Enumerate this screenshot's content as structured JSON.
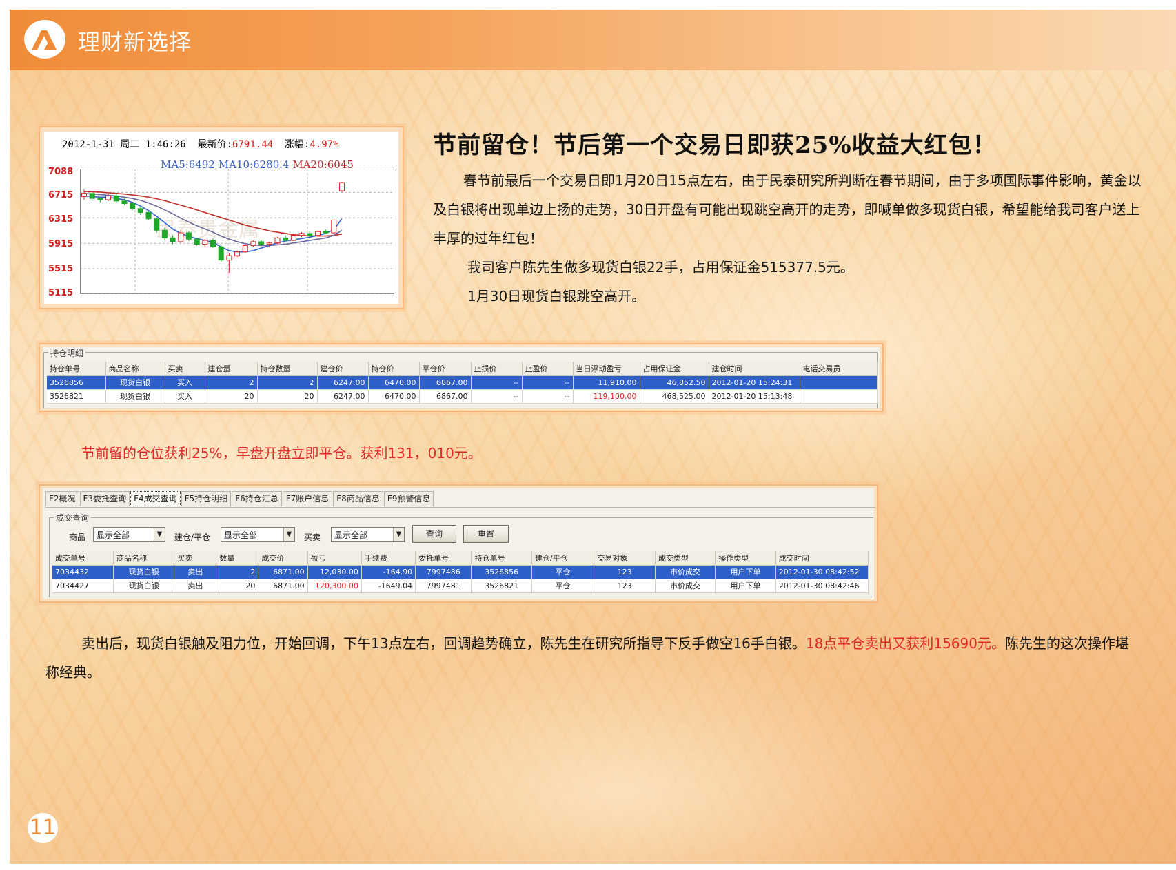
{
  "header": {
    "title": "理财新选择",
    "logo_icon": "logo-icon",
    "colors": {
      "bar_start": "#f08c38",
      "bar_end": "#fbd9b4",
      "accent_red": "#e02a2a"
    }
  },
  "chart_panel": {
    "date": "2012-1-31",
    "weekday": "周二",
    "time": "1:46:26",
    "latest_label": "最新价:",
    "latest_value": "6791.44",
    "change_label": "涨幅:",
    "change_value": "4.97%",
    "ma5": "MA5:6492",
    "ma10": "MA10:6280.4",
    "ma20": "MA20:6045",
    "watermark": "民泰贵金属",
    "y_ticks": [
      "7088",
      "6715",
      "6315",
      "5915",
      "5515",
      "5115"
    ]
  },
  "chart_data": {
    "type": "candlestick",
    "ylim": [
      5115,
      7088
    ],
    "y_ticks": [
      7088,
      6715,
      6315,
      5915,
      5515,
      5115
    ],
    "candles": [
      [
        6650,
        6760,
        6600,
        6700
      ],
      [
        6700,
        6690,
        6580,
        6620
      ],
      [
        6620,
        6650,
        6560,
        6600
      ],
      [
        6600,
        6700,
        6580,
        6660
      ],
      [
        6660,
        6700,
        6560,
        6580
      ],
      [
        6580,
        6620,
        6520,
        6540
      ],
      [
        6540,
        6560,
        6440,
        6460
      ],
      [
        6460,
        6500,
        6360,
        6400
      ],
      [
        6400,
        6420,
        6280,
        6300
      ],
      [
        6300,
        6320,
        6080,
        6120
      ],
      [
        6120,
        6160,
        5960,
        6000
      ],
      [
        6000,
        6040,
        5900,
        5940
      ],
      [
        5940,
        6120,
        5920,
        6080
      ],
      [
        6080,
        6110,
        5950,
        5980
      ],
      [
        5980,
        6000,
        5880,
        5900
      ],
      [
        5900,
        5980,
        5860,
        5960
      ],
      [
        5960,
        5990,
        5840,
        5860
      ],
      [
        5860,
        5880,
        5620,
        5650
      ],
      [
        5650,
        5760,
        5450,
        5720
      ],
      [
        5720,
        5800,
        5700,
        5780
      ],
      [
        5780,
        5900,
        5760,
        5880
      ],
      [
        5880,
        5960,
        5860,
        5940
      ],
      [
        5940,
        5960,
        5880,
        5900
      ],
      [
        5900,
        5940,
        5860,
        5920
      ],
      [
        5920,
        6020,
        5900,
        6000
      ],
      [
        6000,
        6040,
        5940,
        5960
      ],
      [
        5960,
        6060,
        5950,
        6040
      ],
      [
        6040,
        6090,
        6010,
        6070
      ],
      [
        6070,
        6100,
        6020,
        6040
      ],
      [
        6040,
        6110,
        6030,
        6100
      ],
      [
        6100,
        6130,
        6060,
        6080
      ],
      [
        6080,
        6300,
        6070,
        6280
      ],
      [
        6740,
        6880,
        6720,
        6870
      ]
    ],
    "ma5": [
      6660,
      6650,
      6640,
      6640,
      6620,
      6600,
      6560,
      6500,
      6430,
      6340,
      6240,
      6140,
      6070,
      6020,
      5990,
      5960,
      5930,
      5860,
      5800,
      5780,
      5780,
      5800,
      5840,
      5880,
      5920,
      5950,
      5970,
      5990,
      6010,
      6040,
      6070,
      6130,
      6300
    ],
    "ma10": [
      6700,
      6690,
      6680,
      6670,
      6660,
      6640,
      6620,
      6590,
      6550,
      6500,
      6440,
      6380,
      6310,
      6250,
      6190,
      6140,
      6090,
      6030,
      5980,
      5940,
      5910,
      5890,
      5880,
      5880,
      5890,
      5900,
      5920,
      5940,
      5960,
      5980,
      6000,
      6040,
      6120
    ],
    "ma20": [
      6730,
      6725,
      6720,
      6710,
      6700,
      6690,
      6675,
      6660,
      6640,
      6615,
      6585,
      6550,
      6515,
      6480,
      6440,
      6400,
      6360,
      6320,
      6280,
      6240,
      6200,
      6170,
      6140,
      6110,
      6090,
      6070,
      6050,
      6040,
      6030,
      6030,
      6030,
      6040,
      6060
    ]
  },
  "article": {
    "headline": "节前留仓！节后第一个交易日即获25%收益大红包！",
    "para1": "春节前最后一个交易日即1月20日15点左右，由于民泰研究所判断在春节期间，由于多项国际事件影响，黄金以及白银将出现单边上扬的走势，30日开盘有可能出现跳空高开的走势，即喊单做多现货白银，希望能给我司客户送上丰厚的过年红包！",
    "para2": "我司客户陈先生做多现货白银22手，占用保证金515377.5元。",
    "para3": "1月30日现货白银跳空高开。",
    "red_note": "节前留的仓位获利25%，早盘开盘立即平仓。获利131，010元。",
    "bottom_black": "卖出后，现货白银触及阻力位，开始回调，下午13点左右，回调趋势确立，陈先生在研究所指导下反手做空16手白银。",
    "bottom_red": "18点平仓卖出又获利15690元。",
    "bottom_tail": "陈先生的这次操作堪称经典。"
  },
  "positions": {
    "group_title": "持仓明细",
    "headers": [
      "持仓单号",
      "商品名称",
      "买卖",
      "建仓量",
      "持仓数量",
      "建仓价",
      "持仓价",
      "平仓价",
      "止损价",
      "止盈价",
      "当日浮动盈亏",
      "占用保证金",
      "建仓时间",
      "电话交易员"
    ],
    "rows": [
      [
        "3526856",
        "现货白银",
        "买入",
        "2",
        "2",
        "6247.00",
        "6470.00",
        "6867.00",
        "--",
        "--",
        "11,910.00",
        "46,852.50",
        "2012-01-20 15:24:31",
        ""
      ],
      [
        "3526821",
        "现货白银",
        "买入",
        "20",
        "20",
        "6247.00",
        "6470.00",
        "6867.00",
        "--",
        "--",
        "119,100.00",
        "468,525.00",
        "2012-01-20 15:13:48",
        ""
      ]
    ]
  },
  "trades": {
    "tabs": [
      "F2概况",
      "F3委托查询",
      "F4成交查询",
      "F5持仓明细",
      "F6持仓汇总",
      "F7账户信息",
      "F8商品信息",
      "F9预警信息"
    ],
    "active_tab": "F4成交查询",
    "group_title": "成交查询",
    "filter_product_label": "商品",
    "filter_product_value": "显示全部",
    "filter_openclose_label": "建仓/平仓",
    "filter_openclose_value": "显示全部",
    "filter_side_label": "买卖",
    "filter_side_value": "显示全部",
    "query_button": "查询",
    "reset_button": "重置",
    "headers": [
      "成交单号",
      "商品名称",
      "买卖",
      "数量",
      "成交价",
      "盈亏",
      "手续费",
      "委托单号",
      "持仓单号",
      "建仓/平仓",
      "交易对象",
      "成交类型",
      "操作类型",
      "成交时间"
    ],
    "rows": [
      [
        "7034432",
        "现货白银",
        "卖出",
        "2",
        "6871.00",
        "12,030.00",
        "-164.90",
        "7997486",
        "3526856",
        "平仓",
        "123",
        "市价成交",
        "用户下单",
        "2012-01-30 08:42:52"
      ],
      [
        "7034427",
        "现货白银",
        "卖出",
        "20",
        "6871.00",
        "120,300.00",
        "-1649.04",
        "7997481",
        "3526821",
        "平仓",
        "123",
        "市价成交",
        "用户下单",
        "2012-01-30 08:42:46"
      ]
    ]
  },
  "page_number": "11"
}
